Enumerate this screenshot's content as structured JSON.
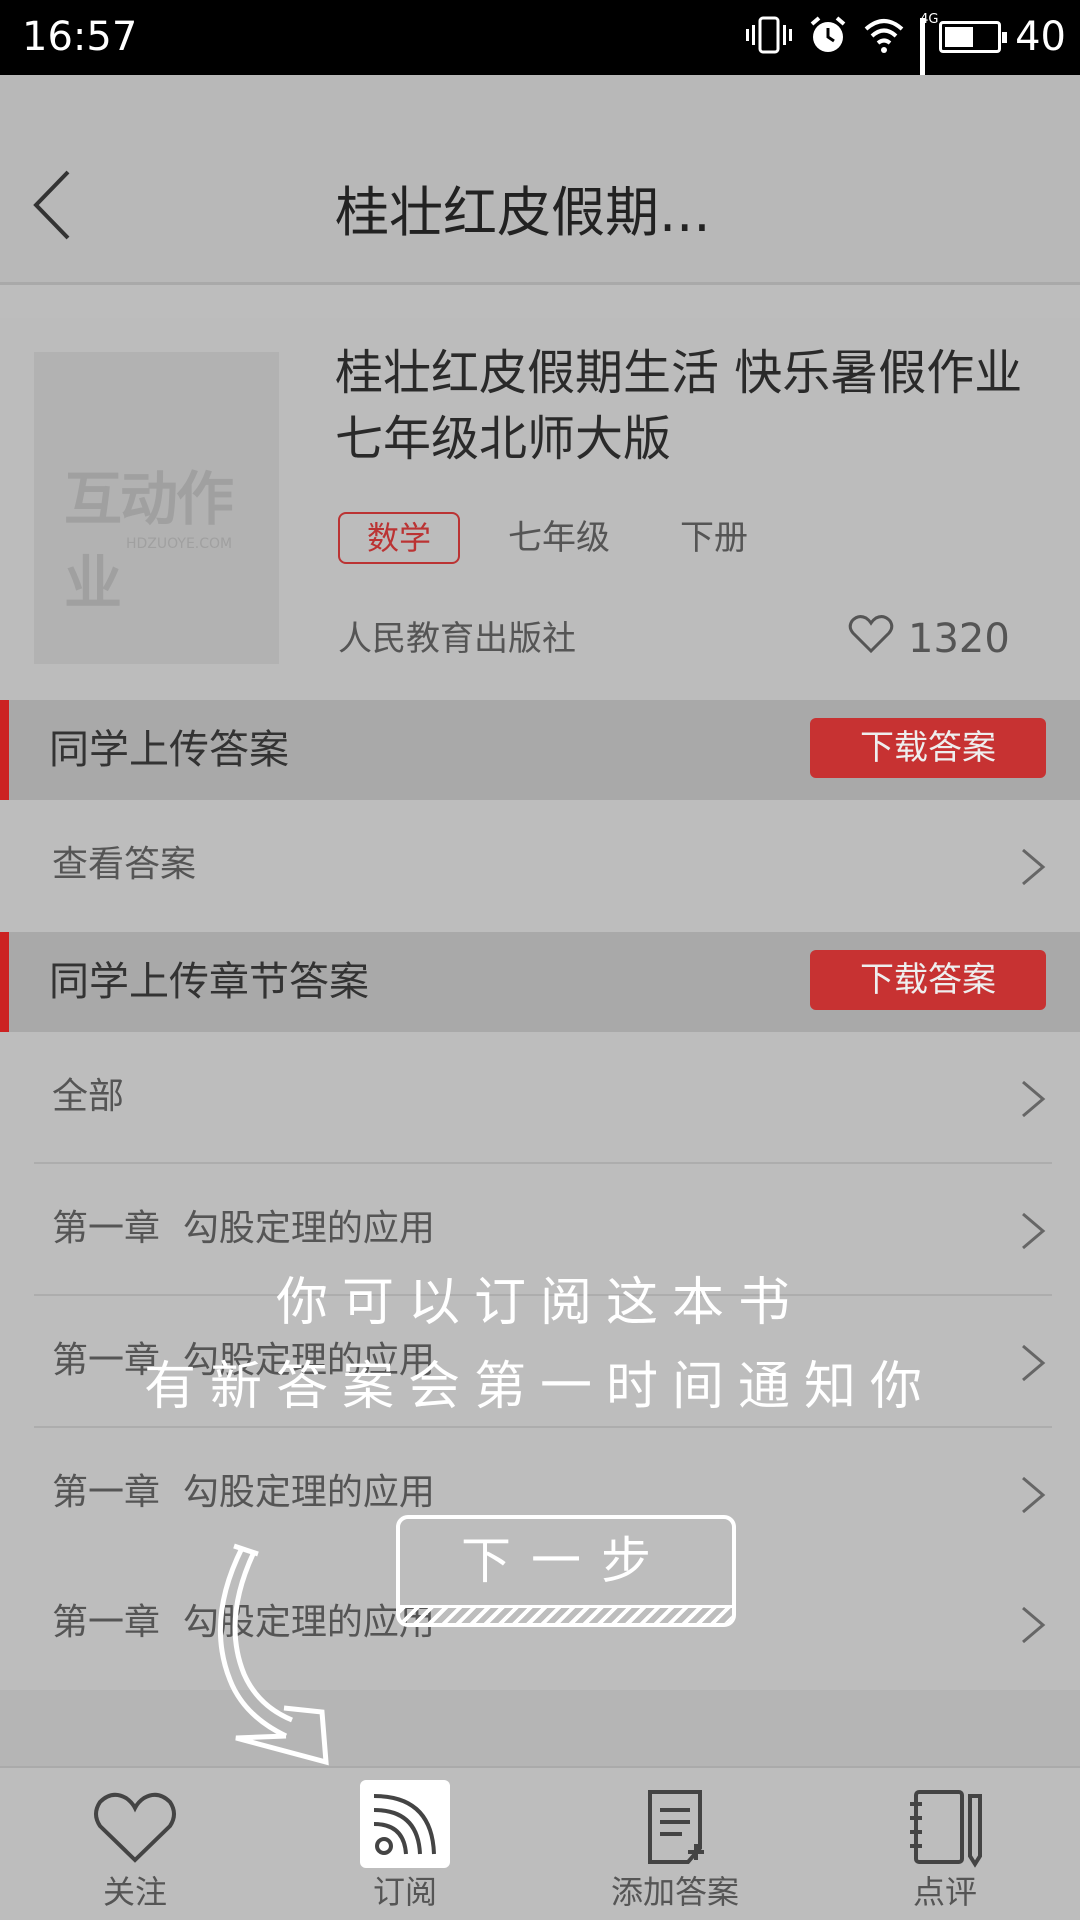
{
  "status_bar": {
    "time": "16:57",
    "battery": "40",
    "network": "4G"
  },
  "header": {
    "title": "桂壮红皮假期..."
  },
  "book": {
    "cover_logo": "互动作业",
    "cover_logo_sub": "HDZUOYE.COM",
    "title": "桂壮红皮假期生活 快乐暑假作业七年级北师大版",
    "subject": "数学",
    "grade": "七年级",
    "volume": "下册",
    "publisher": "人民教育出版社",
    "likes": "1320"
  },
  "sections": [
    {
      "label": "同学上传答案",
      "button": "下载答案",
      "rows": [
        "查看答案"
      ]
    },
    {
      "label": "同学上传章节答案",
      "button": "下载答案",
      "rows": [
        "全部",
        "第一章  勾股定理的应用",
        "第一章  勾股定理的应用",
        "第一章  勾股定理的应用",
        "第一章  勾股定理的应用"
      ]
    }
  ],
  "tabs": [
    {
      "label": "关注",
      "icon": "heart-icon"
    },
    {
      "label": "订阅",
      "icon": "rss-icon"
    },
    {
      "label": "添加答案",
      "icon": "add-note-icon"
    },
    {
      "label": "点评",
      "icon": "review-notebook-icon"
    }
  ],
  "overlay": {
    "line1": "你可以订阅这本书",
    "line2": "有新答案会第一时间通知你",
    "next_button": "下一步"
  },
  "colors": {
    "accent": "#c73232",
    "dim_background": "#bdbdbd"
  }
}
